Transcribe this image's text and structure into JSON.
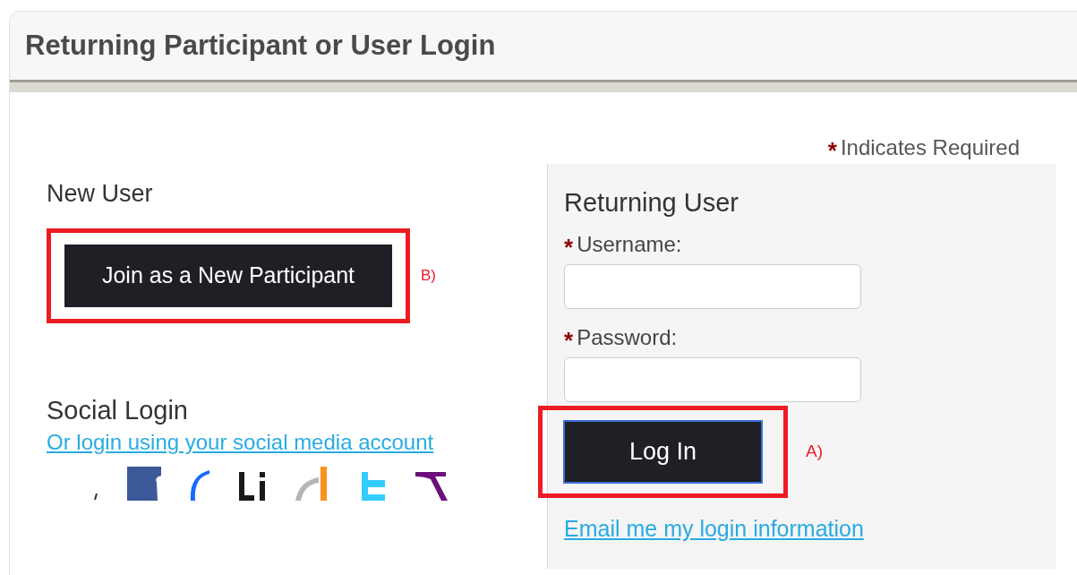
{
  "panel": {
    "title": "Returning Participant or User Login"
  },
  "required_note": {
    "mark": "*",
    "text": "Indicates Required"
  },
  "new_user": {
    "heading": "New User",
    "button": "Join as a New Participant",
    "annotation": "B)"
  },
  "social": {
    "heading": "Social Login",
    "link": "Or login using your social media account"
  },
  "returning_user": {
    "heading": "Returning User",
    "fields": [
      {
        "label": "Username:",
        "required": true,
        "mark": "*"
      },
      {
        "label": "Password:",
        "required": true,
        "mark": "*"
      }
    ],
    "button": "Log In",
    "annotation": "A)",
    "link": "Email me my login information"
  }
}
